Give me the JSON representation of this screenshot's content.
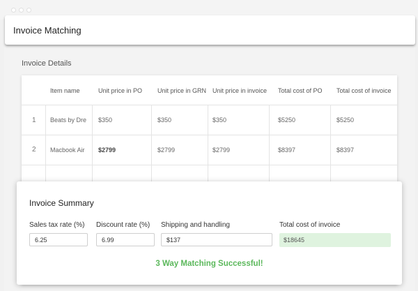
{
  "app": {
    "title": "Invoice Matching"
  },
  "details": {
    "title": "Invoice Details",
    "columns": [
      "Item name",
      "Unit price in PO",
      "Unit price in GRN",
      "Unit price in invoice",
      "Total cost of PO",
      "Total cost of invoice"
    ],
    "rows": [
      {
        "num": "1",
        "item": "Beats by Dre",
        "po": "$350",
        "grn": "$350",
        "inv": "$350",
        "total_po": "$5250",
        "total_inv": "$5250"
      },
      {
        "num": "2",
        "item": "Macbook Air",
        "po": "$2799",
        "grn": "$2799",
        "inv": "$2799",
        "total_po": "$8397",
        "total_inv": "$8397"
      }
    ]
  },
  "summary": {
    "title": "Invoice Summary",
    "fields": [
      {
        "label": "Sales tax rate (%)",
        "value": "6.25"
      },
      {
        "label": "Discount rate (%)",
        "value": "6.99"
      },
      {
        "label": "Shipping and handling",
        "value": "$137"
      },
      {
        "label": "Total cost of invoice",
        "value": "$18645"
      }
    ],
    "status": "3 Way Matching Successful!"
  },
  "colors": {
    "success": "#5cb85c",
    "total_bg": "#dff3df"
  }
}
